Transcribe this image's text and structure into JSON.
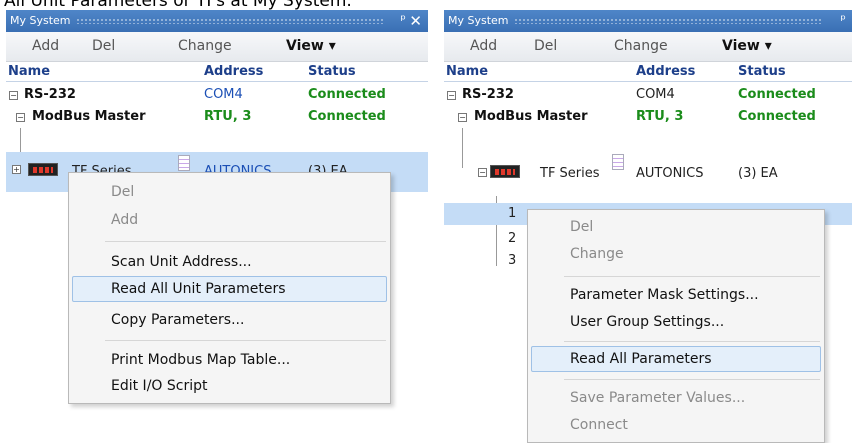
{
  "caption": "All Unit Parameters or TFs at My System.",
  "left": {
    "title": "My System",
    "toolbar": {
      "add": "Add",
      "del": "Del",
      "change": "Change",
      "view": "View ▾"
    },
    "columns": {
      "name": "Name",
      "address": "Address",
      "status": "Status"
    },
    "rows": [
      {
        "name": "RS-232",
        "address": "COM4",
        "status": "Connected"
      },
      {
        "name": "ModBus Master",
        "address": "RTU, 3",
        "status": "Connected"
      },
      {
        "name": "TF Series",
        "address": "AUTONICS",
        "status": "(3) EA"
      }
    ],
    "menu": {
      "del": "Del",
      "add": "Add",
      "scan": "Scan Unit Address...",
      "read_all": "Read All Unit Parameters",
      "copy": "Copy Parameters...",
      "print": "Print Modbus Map Table...",
      "edit_io": "Edit I/O Script"
    }
  },
  "right": {
    "title": "My System",
    "toolbar": {
      "add": "Add",
      "del": "Del",
      "change": "Change",
      "view": "View ▾"
    },
    "columns": {
      "name": "Name",
      "address": "Address",
      "status": "Status"
    },
    "rows": [
      {
        "name": "RS-232",
        "address": "COM4",
        "status": "Connected"
      },
      {
        "name": "ModBus Master",
        "address": "RTU, 3",
        "status": "Connected"
      },
      {
        "name": "TF Series",
        "address": "AUTONICS",
        "status": "(3) EA"
      }
    ],
    "units": [
      "1",
      "2",
      "3"
    ],
    "menu": {
      "del": "Del",
      "change": "Change",
      "mask": "Parameter Mask Settings...",
      "user_group": "User Group Settings...",
      "read_all": "Read All Parameters",
      "save": "Save Parameter Values...",
      "connect": "Connect"
    }
  },
  "colors": {
    "title_bar": "#3a6fb4",
    "selection": "#c4dcf6",
    "connected": "#1b8c1b",
    "header": "#1d3f8a"
  }
}
